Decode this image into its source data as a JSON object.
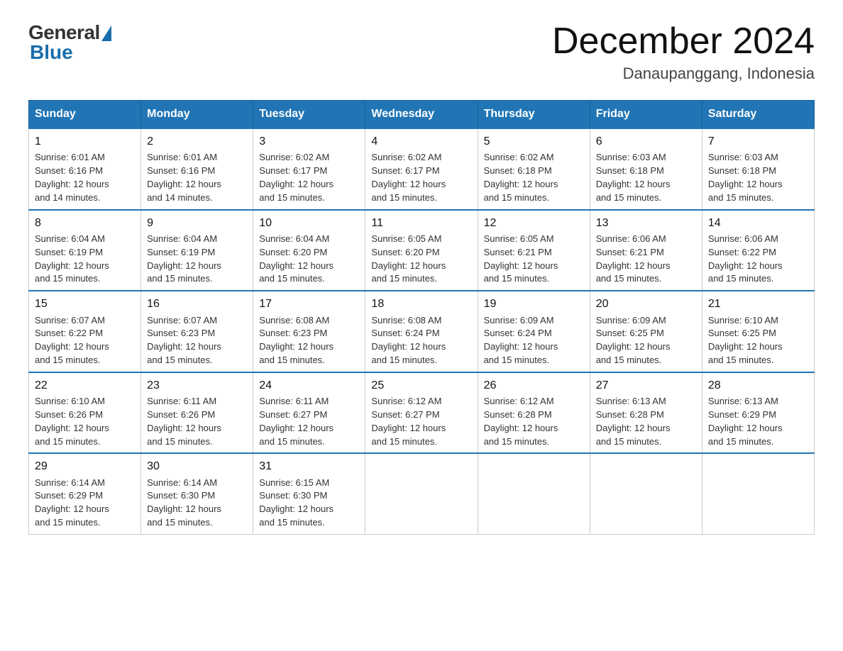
{
  "header": {
    "logo_general": "General",
    "logo_blue": "Blue",
    "month_title": "December 2024",
    "location": "Danaupanggang, Indonesia"
  },
  "weekdays": [
    "Sunday",
    "Monday",
    "Tuesday",
    "Wednesday",
    "Thursday",
    "Friday",
    "Saturday"
  ],
  "weeks": [
    [
      {
        "day": "1",
        "sunrise": "6:01 AM",
        "sunset": "6:16 PM",
        "daylight": "12 hours and 14 minutes."
      },
      {
        "day": "2",
        "sunrise": "6:01 AM",
        "sunset": "6:16 PM",
        "daylight": "12 hours and 14 minutes."
      },
      {
        "day": "3",
        "sunrise": "6:02 AM",
        "sunset": "6:17 PM",
        "daylight": "12 hours and 15 minutes."
      },
      {
        "day": "4",
        "sunrise": "6:02 AM",
        "sunset": "6:17 PM",
        "daylight": "12 hours and 15 minutes."
      },
      {
        "day": "5",
        "sunrise": "6:02 AM",
        "sunset": "6:18 PM",
        "daylight": "12 hours and 15 minutes."
      },
      {
        "day": "6",
        "sunrise": "6:03 AM",
        "sunset": "6:18 PM",
        "daylight": "12 hours and 15 minutes."
      },
      {
        "day": "7",
        "sunrise": "6:03 AM",
        "sunset": "6:18 PM",
        "daylight": "12 hours and 15 minutes."
      }
    ],
    [
      {
        "day": "8",
        "sunrise": "6:04 AM",
        "sunset": "6:19 PM",
        "daylight": "12 hours and 15 minutes."
      },
      {
        "day": "9",
        "sunrise": "6:04 AM",
        "sunset": "6:19 PM",
        "daylight": "12 hours and 15 minutes."
      },
      {
        "day": "10",
        "sunrise": "6:04 AM",
        "sunset": "6:20 PM",
        "daylight": "12 hours and 15 minutes."
      },
      {
        "day": "11",
        "sunrise": "6:05 AM",
        "sunset": "6:20 PM",
        "daylight": "12 hours and 15 minutes."
      },
      {
        "day": "12",
        "sunrise": "6:05 AM",
        "sunset": "6:21 PM",
        "daylight": "12 hours and 15 minutes."
      },
      {
        "day": "13",
        "sunrise": "6:06 AM",
        "sunset": "6:21 PM",
        "daylight": "12 hours and 15 minutes."
      },
      {
        "day": "14",
        "sunrise": "6:06 AM",
        "sunset": "6:22 PM",
        "daylight": "12 hours and 15 minutes."
      }
    ],
    [
      {
        "day": "15",
        "sunrise": "6:07 AM",
        "sunset": "6:22 PM",
        "daylight": "12 hours and 15 minutes."
      },
      {
        "day": "16",
        "sunrise": "6:07 AM",
        "sunset": "6:23 PM",
        "daylight": "12 hours and 15 minutes."
      },
      {
        "day": "17",
        "sunrise": "6:08 AM",
        "sunset": "6:23 PM",
        "daylight": "12 hours and 15 minutes."
      },
      {
        "day": "18",
        "sunrise": "6:08 AM",
        "sunset": "6:24 PM",
        "daylight": "12 hours and 15 minutes."
      },
      {
        "day": "19",
        "sunrise": "6:09 AM",
        "sunset": "6:24 PM",
        "daylight": "12 hours and 15 minutes."
      },
      {
        "day": "20",
        "sunrise": "6:09 AM",
        "sunset": "6:25 PM",
        "daylight": "12 hours and 15 minutes."
      },
      {
        "day": "21",
        "sunrise": "6:10 AM",
        "sunset": "6:25 PM",
        "daylight": "12 hours and 15 minutes."
      }
    ],
    [
      {
        "day": "22",
        "sunrise": "6:10 AM",
        "sunset": "6:26 PM",
        "daylight": "12 hours and 15 minutes."
      },
      {
        "day": "23",
        "sunrise": "6:11 AM",
        "sunset": "6:26 PM",
        "daylight": "12 hours and 15 minutes."
      },
      {
        "day": "24",
        "sunrise": "6:11 AM",
        "sunset": "6:27 PM",
        "daylight": "12 hours and 15 minutes."
      },
      {
        "day": "25",
        "sunrise": "6:12 AM",
        "sunset": "6:27 PM",
        "daylight": "12 hours and 15 minutes."
      },
      {
        "day": "26",
        "sunrise": "6:12 AM",
        "sunset": "6:28 PM",
        "daylight": "12 hours and 15 minutes."
      },
      {
        "day": "27",
        "sunrise": "6:13 AM",
        "sunset": "6:28 PM",
        "daylight": "12 hours and 15 minutes."
      },
      {
        "day": "28",
        "sunrise": "6:13 AM",
        "sunset": "6:29 PM",
        "daylight": "12 hours and 15 minutes."
      }
    ],
    [
      {
        "day": "29",
        "sunrise": "6:14 AM",
        "sunset": "6:29 PM",
        "daylight": "12 hours and 15 minutes."
      },
      {
        "day": "30",
        "sunrise": "6:14 AM",
        "sunset": "6:30 PM",
        "daylight": "12 hours and 15 minutes."
      },
      {
        "day": "31",
        "sunrise": "6:15 AM",
        "sunset": "6:30 PM",
        "daylight": "12 hours and 15 minutes."
      },
      null,
      null,
      null,
      null
    ]
  ],
  "labels": {
    "sunrise": "Sunrise:",
    "sunset": "Sunset:",
    "daylight": "Daylight:"
  }
}
